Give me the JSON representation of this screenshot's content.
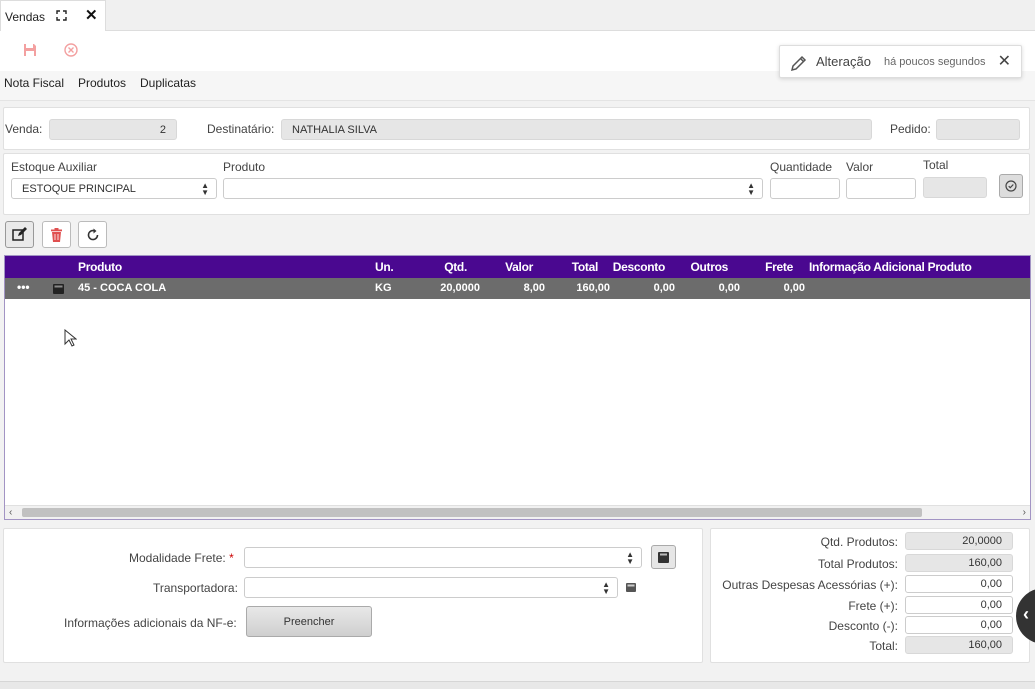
{
  "tab": {
    "title": "Vendas"
  },
  "toast": {
    "title": "Alteração",
    "time": "há poucos segundos"
  },
  "menu": {
    "items": [
      "Nota Fiscal",
      "Produtos",
      "Duplicatas"
    ]
  },
  "header": {
    "venda_label": "Venda:",
    "venda_value": "2",
    "destinatario_label": "Destinatário:",
    "destinatario_value": "NATHALIA SILVA",
    "pedido_label": "Pedido:",
    "pedido_value": ""
  },
  "product_entry": {
    "estoque_label": "Estoque Auxiliar",
    "estoque_value": "ESTOQUE PRINCIPAL",
    "produto_label": "Produto",
    "produto_value": "",
    "quantidade_label": "Quantidade",
    "valor_label": "Valor",
    "total_label": "Total"
  },
  "grid": {
    "columns": [
      "Produto",
      "Un.",
      "Qtd.",
      "Valor",
      "Total",
      "Desconto",
      "Outros",
      "Frete",
      "Informação Adicional Produto"
    ],
    "rows": [
      {
        "menu": "•••",
        "produto": "45 - COCA COLA",
        "un": "KG",
        "qtd": "20,0000",
        "valor": "8,00",
        "total": "160,00",
        "desconto": "0,00",
        "outros": "0,00",
        "frete": "0,00",
        "info": ""
      }
    ]
  },
  "transport": {
    "modalidade_label": "Modalidade Frete:",
    "required_mark": "*",
    "transportadora_label": "Transportadora:",
    "info_label": "Informações adicionais da NF-e:",
    "fill_button": "Preencher"
  },
  "totals": {
    "qtd_produtos_label": "Qtd. Produtos:",
    "qtd_produtos": "20,0000",
    "total_produtos_label": "Total Produtos:",
    "total_produtos": "160,00",
    "outras_label": "Outras Despesas Acessórias (+):",
    "outras": "0,00",
    "frete_label": "Frete (+):",
    "frete": "0,00",
    "desconto_label": "Desconto (-):",
    "desconto": "0,00",
    "total_label": "Total:",
    "total": "160,00"
  },
  "colors": {
    "grid_header": "#4a0890",
    "selected_row": "#6c6c6c",
    "danger": "#e05050"
  }
}
